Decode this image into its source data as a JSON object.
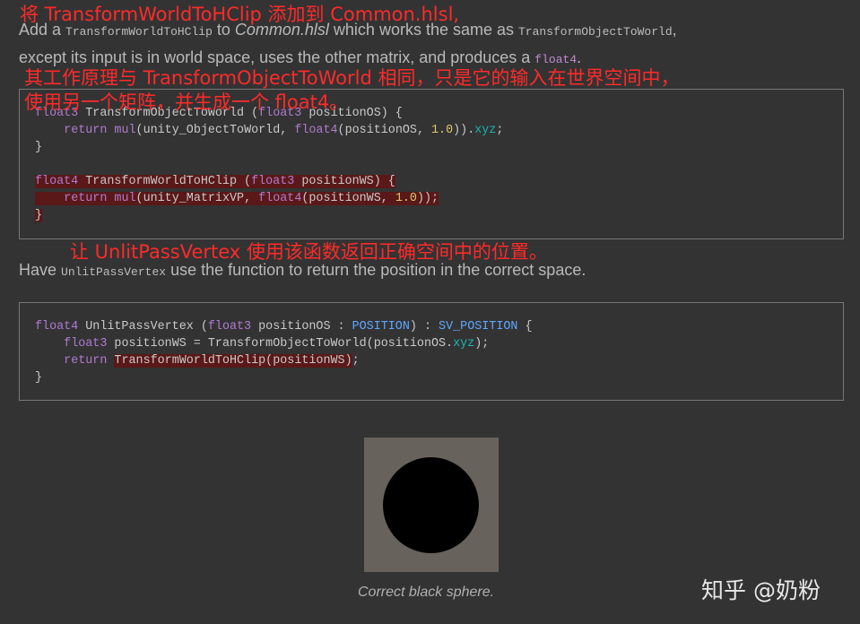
{
  "annotations": {
    "a1": "将 TransformWorldToHClip 添加到 Common.hlsl,",
    "a2": "其工作原理与 TransformObjectToWorld 相同，只是它的输入在世界空间中，",
    "a3": "使用另一个矩阵，并生成一个 float4。",
    "a4": "让 UnlitPassVertex 使用该函数返回正确空间中的位置。"
  },
  "para1": {
    "t1": "Add a ",
    "c1": "TransformWorldToHClip",
    "t2": " to ",
    "i1": "Common.hlsl",
    "t3": " which works the same as ",
    "c2": "TransformObjectToWorld",
    "t4": ",",
    "t5": "except its input is in world space, uses the other matrix, and produces a ",
    "c3": "float4",
    "t6": "."
  },
  "code1": {
    "l1": {
      "a": "float3",
      "b": " TransformObjectToWorld (",
      "c": "float3",
      "d": " positionOS) {"
    },
    "l2": {
      "a": "    ",
      "b": "return",
      "c": " ",
      "d": "mul",
      "e": "(unity_ObjectToWorld, ",
      "f": "float4",
      "g": "(positionOS, ",
      "h": "1.0",
      "i": ")).",
      "j": "xyz",
      "k": ";"
    },
    "l3": "}",
    "l5": {
      "a": "float4",
      "b": " TransformWorldToHClip (",
      "c": "float3",
      "d": " positionWS) {"
    },
    "l6": {
      "a": "    ",
      "b": "return",
      "c": " ",
      "d": "mul",
      "e": "(unity_MatrixVP, ",
      "f": "float4",
      "g": "(positionWS, ",
      "h": "1.0",
      "i": "));"
    },
    "l7": "}"
  },
  "para2": {
    "t1": "Have ",
    "c1": "UnlitPassVertex",
    "t2": " use the function to return the position in the correct space."
  },
  "code2": {
    "l1": {
      "a": "float4",
      "b": " UnlitPassVertex (",
      "c": "float3",
      "d": " positionOS : ",
      "e": "POSITION",
      "f": ") : ",
      "g": "SV_POSITION",
      "h": " {"
    },
    "l2": {
      "a": "    ",
      "b": "float3",
      "c": " positionWS = TransformObjectToWorld(positionOS.",
      "d": "xyz",
      "e": ");"
    },
    "l3": {
      "a": "    ",
      "b": "return",
      "c": " ",
      "d": "TransformWorldToHClip(positionWS)",
      "e": ";"
    },
    "l4": "}"
  },
  "figure": {
    "caption": "Correct black sphere."
  },
  "watermark": "知乎 @奶粉"
}
